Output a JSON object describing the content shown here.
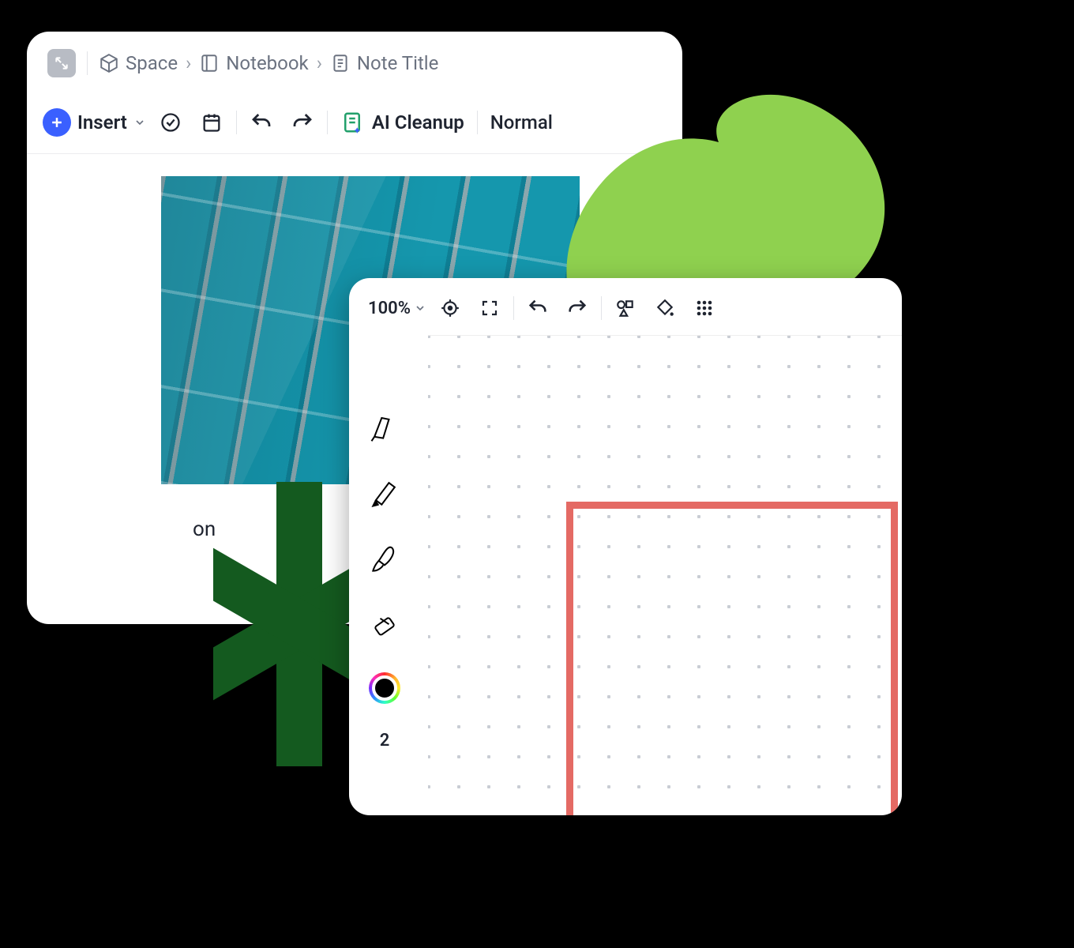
{
  "note_app": {
    "breadcrumb": {
      "space": "Space",
      "notebook": "Notebook",
      "note": "Note Title"
    },
    "toolbar": {
      "insert_label": "Insert",
      "ai_cleanup_label": "AI Cleanup",
      "text_style": "Normal"
    },
    "body_text_fragment": "on"
  },
  "canvas_app": {
    "zoom": "100%",
    "stroke_width": "2"
  },
  "colors": {
    "accent_blue": "#3a60ff",
    "red_shape": "#e46a64",
    "leaf_green": "#8fd14f",
    "dark_green": "#145a1f"
  }
}
